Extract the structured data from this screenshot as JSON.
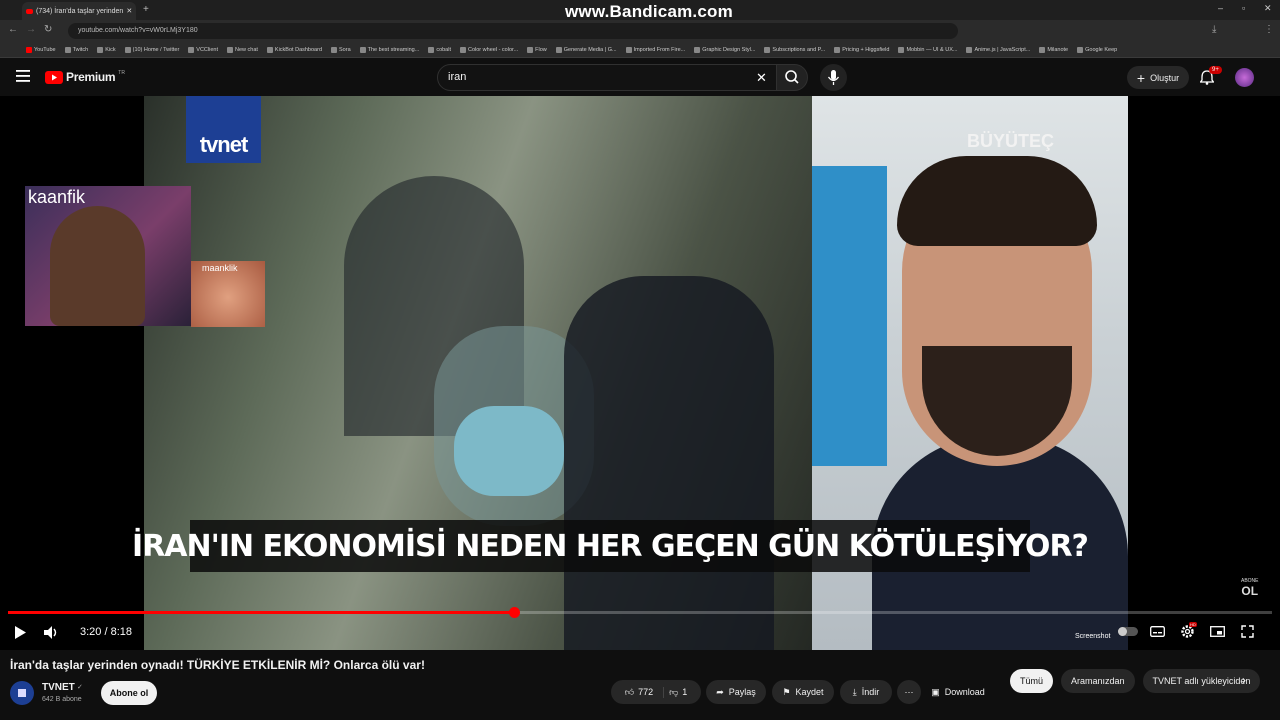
{
  "browser": {
    "tab_title": "(734) İran'da taşlar yerinden",
    "url": "youtube.com/watch?v=vW0rLMj3Y180",
    "bookmarks": [
      "YouTube",
      "Twitch",
      "Kick",
      "(10) Home / Twitter",
      "VCClient",
      "New chat",
      "KickBot Dashboard",
      "Sora",
      "The best streaming...",
      "cobalt",
      "Color wheel - color...",
      "Flow",
      "Generate Media | G...",
      "Imported From Fire...",
      "Graphic Design Styl...",
      "Subscriptions and P...",
      "Pricing + Higgsfield",
      "Mobbin — UI & UX...",
      "Anime.js | JavaScript...",
      "Milanote",
      "Google Keep"
    ]
  },
  "watermark": "www.Bandicam.com",
  "header": {
    "logo": "Premium",
    "region": "TR",
    "search_value": "iran",
    "create_label": "Oluştur",
    "notif_count": "9+"
  },
  "video": {
    "channel_logo": "tvnet",
    "overlay_user_main": "kaanfik",
    "overlay_user_small": "maanklik",
    "right_logo": "BÜYÜTEÇ",
    "banner": "İRAN'IN EKONOMİSİ NEDEN HER GEÇEN GÜN KÖTÜLEŞİYOR?",
    "subscribe_corner": [
      "ABONE",
      "OL"
    ],
    "time": "3:20 / 8:18",
    "progress": 0.4,
    "screenshot_label": "Screenshot",
    "settings_badge": "HD"
  },
  "below": {
    "title": "İran'da taşlar yerinden oynadı! TÜRKİYE ETKİLENİR Mİ? Onlarca ölü var!",
    "channel": "TVNET",
    "subscribers": "642 B abone",
    "subscribe_label": "Abone ol",
    "likes": "772",
    "dislikes": "1",
    "share_label": "Paylaş",
    "save_label": "Kaydet",
    "download_label": "İndir",
    "download2_label": "Download",
    "chips": [
      "Tümü",
      "Aramanızdan",
      "TVNET adlı yükleyiciden"
    ]
  }
}
